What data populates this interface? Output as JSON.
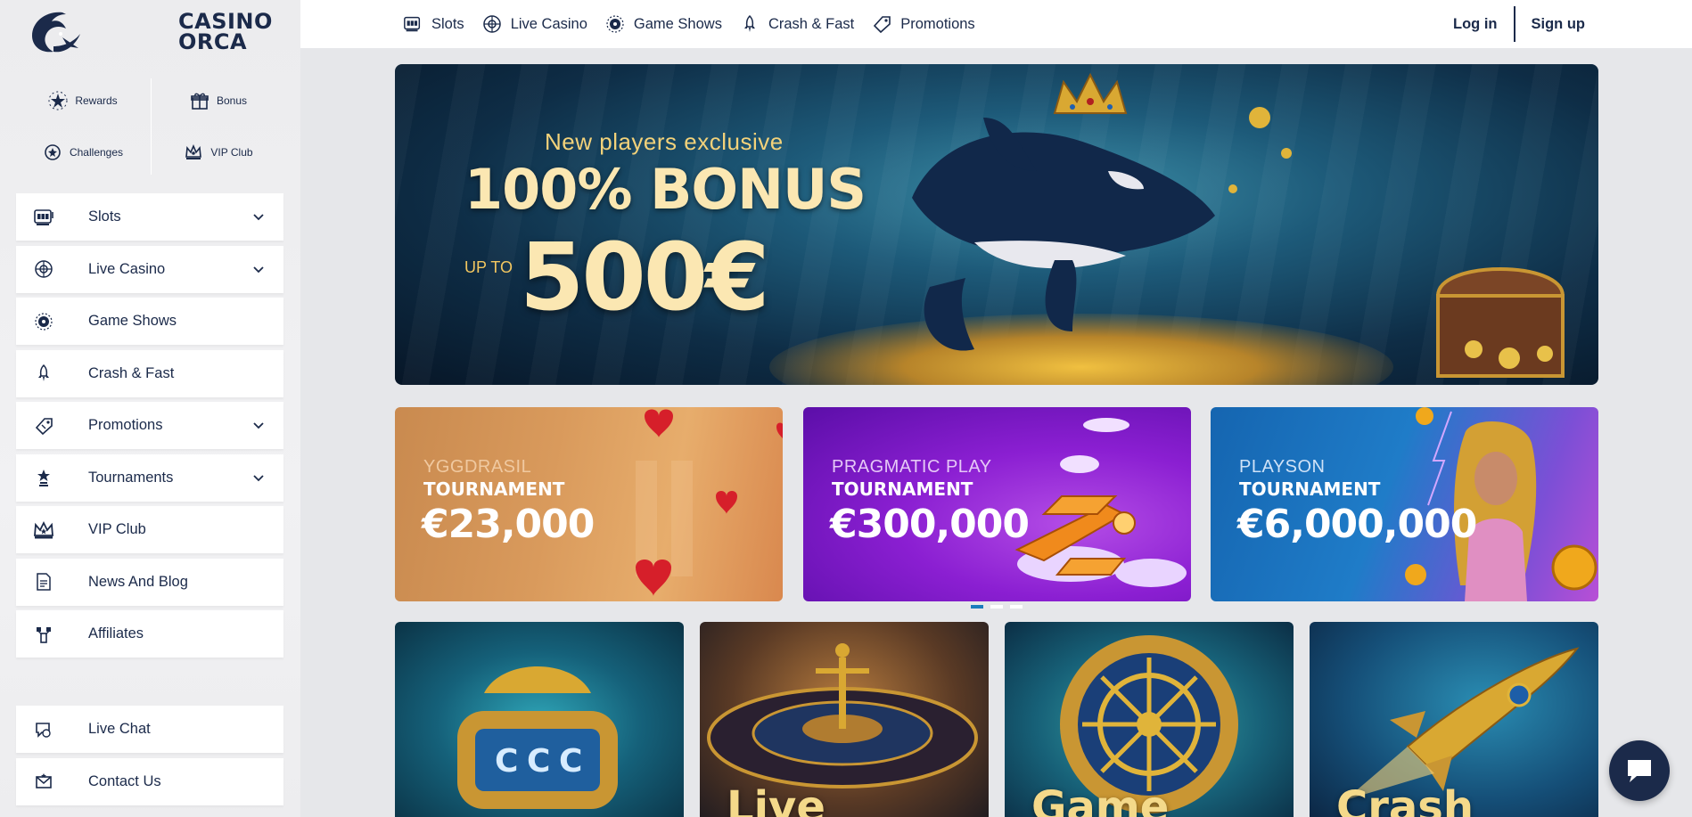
{
  "brand": {
    "line1": "CASINO",
    "line2": "ORCA",
    "logo_icon": "orca-logo-icon",
    "accent": "#1b2a4a",
    "highlight": "#1a7dbd"
  },
  "quick_links": [
    {
      "label": "Rewards",
      "icon": "star-burst-icon"
    },
    {
      "label": "Bonus",
      "icon": "gift-icon"
    },
    {
      "label": "Challenges",
      "icon": "badge-icon"
    },
    {
      "label": "VIP Club",
      "icon": "crown-icon"
    }
  ],
  "sidebar": {
    "items": [
      {
        "label": "Slots",
        "icon": "slot-machine-icon",
        "has_submenu": true
      },
      {
        "label": "Live Casino",
        "icon": "roulette-icon",
        "has_submenu": true
      },
      {
        "label": "Game Shows",
        "icon": "wheel-icon",
        "has_submenu": false
      },
      {
        "label": "Crash & Fast",
        "icon": "rocket-icon",
        "has_submenu": false
      },
      {
        "label": "Promotions",
        "icon": "tag-icon",
        "has_submenu": true
      },
      {
        "label": "Tournaments",
        "icon": "trophy-icon",
        "has_submenu": true
      },
      {
        "label": "VIP Club",
        "icon": "crown-icon",
        "has_submenu": false
      },
      {
        "label": "News And Blog",
        "icon": "document-icon",
        "has_submenu": false
      },
      {
        "label": "Affiliates",
        "icon": "network-icon",
        "has_submenu": false
      }
    ],
    "bottom": [
      {
        "label": "Live Chat",
        "icon": "chat-icon"
      },
      {
        "label": "Contact Us",
        "icon": "envelope-icon"
      }
    ]
  },
  "topnav": [
    {
      "label": "Slots",
      "icon": "slot-machine-icon"
    },
    {
      "label": "Live Casino",
      "icon": "roulette-icon"
    },
    {
      "label": "Game Shows",
      "icon": "wheel-icon"
    },
    {
      "label": "Crash & Fast",
      "icon": "rocket-icon"
    },
    {
      "label": "Promotions",
      "icon": "tag-icon"
    }
  ],
  "auth": {
    "login": "Log in",
    "signup": "Sign up"
  },
  "hero": {
    "line1": "New players exclusive",
    "line2": "100% BONUS",
    "upto": "UP TO",
    "amount": "500€"
  },
  "promos": [
    {
      "provider": "YGGDRASIL",
      "title": "TOURNAMENT",
      "prize": "€23,000"
    },
    {
      "provider": "PRAGMATIC PLAY",
      "title": "TOURNAMENT",
      "prize": "€300,000"
    },
    {
      "provider": "PLAYSON",
      "title": "TOURNAMENT",
      "prize": "€6,000,000"
    }
  ],
  "carousel": {
    "pages": 3,
    "active": 1
  },
  "tiles": [
    {
      "label": ""
    },
    {
      "label": "Live"
    },
    {
      "label": "Game"
    },
    {
      "label": "Crash"
    }
  ],
  "chat_widget_icon": "chat-bubble-icon"
}
